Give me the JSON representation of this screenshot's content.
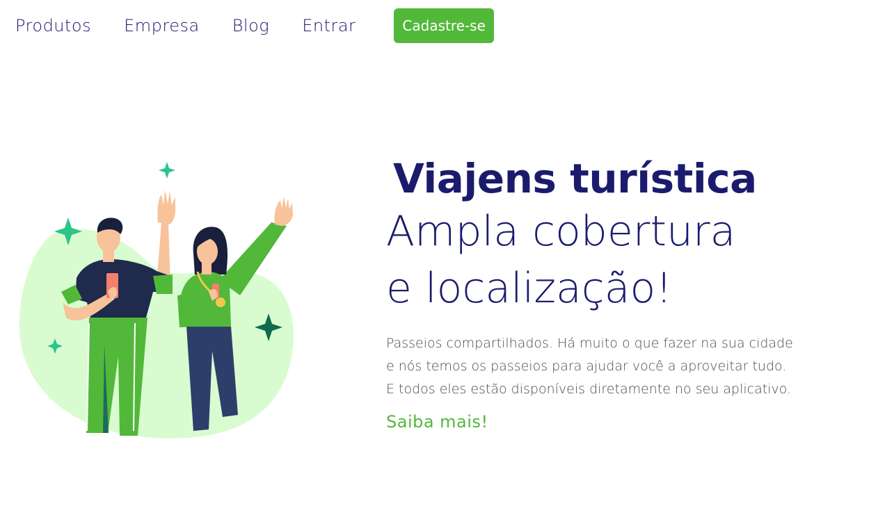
{
  "colors": {
    "navy": "#1b1b6e",
    "green": "#52b83a",
    "light_green_blob": "#d9fbd0",
    "sparkle_green": "#2bc48a",
    "sparkle_dark": "#0e6b4d",
    "pants_navy": "#2e3e6b",
    "skin": "#f8c29a",
    "phone": "#f47f6b",
    "text_gray": "#4a4a4a"
  },
  "nav": {
    "items": [
      {
        "label": "Produtos"
      },
      {
        "label": "Empresa"
      },
      {
        "label": "Blog"
      },
      {
        "label": "Entrar"
      }
    ],
    "cta_label": "Cadastre-se"
  },
  "hero": {
    "title": "Viajens turística",
    "headline_line1": "Ampla cobertura",
    "headline_line2": "e localização!",
    "desc_line1": "Passeios compartilhados. Há muito o que fazer na sua cidade",
    "desc_line2": "e nós temos os passeios para ajudar você a aproveitar tudo.",
    "desc_line3": "E todos eles estão disponíveis diretamente no seu aplicativo.",
    "link_label": "Saiba mais!"
  },
  "illustration": {
    "icons": [
      "sparkle-icon",
      "man-waving",
      "woman-waving"
    ]
  }
}
